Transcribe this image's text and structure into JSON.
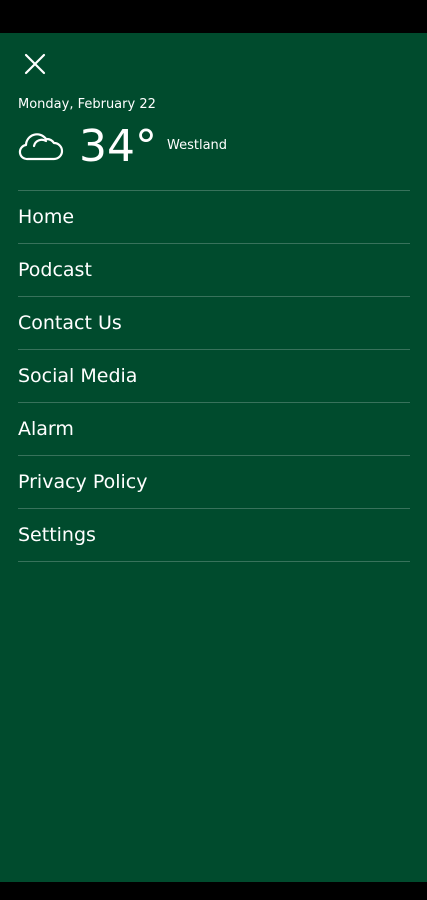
{
  "header": {
    "close_icon": "close-icon",
    "date": "Monday, February 22"
  },
  "weather": {
    "icon": "cloud-icon",
    "temperature": "34°",
    "location": "Westland"
  },
  "menu": {
    "items": [
      {
        "label": "Home"
      },
      {
        "label": "Podcast"
      },
      {
        "label": "Contact Us"
      },
      {
        "label": "Social Media"
      },
      {
        "label": "Alarm"
      },
      {
        "label": "Privacy Policy"
      },
      {
        "label": "Settings"
      }
    ]
  },
  "colors": {
    "drawer_background": "#004b2d",
    "text": "#ffffff",
    "system_bars": "#000000"
  }
}
